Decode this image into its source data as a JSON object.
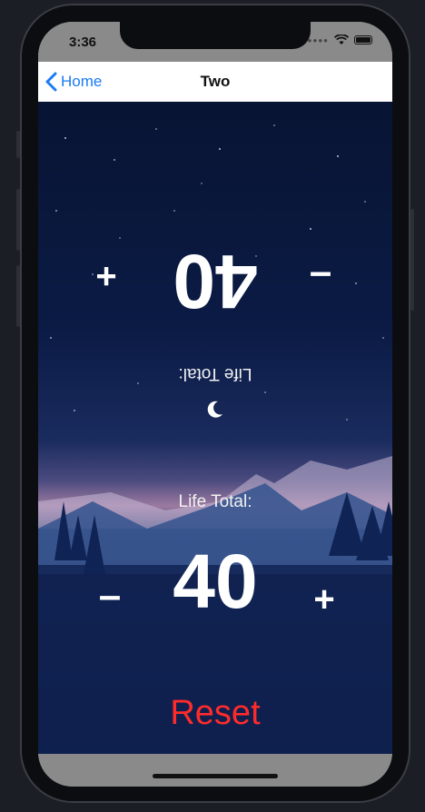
{
  "status_bar": {
    "time": "3:36"
  },
  "nav": {
    "back_label": "Home",
    "title": "Two"
  },
  "player_top": {
    "label": "Life Total:",
    "life": "40",
    "plus": "+",
    "minus": "–"
  },
  "player_bottom": {
    "label": "Life Total:",
    "life": "40",
    "plus": "+",
    "minus": "–"
  },
  "reset": {
    "label": "Reset"
  },
  "colors": {
    "accent_blue": "#1a7cf2",
    "reset_red": "#ff2b2b",
    "sky_top": "#081433"
  }
}
